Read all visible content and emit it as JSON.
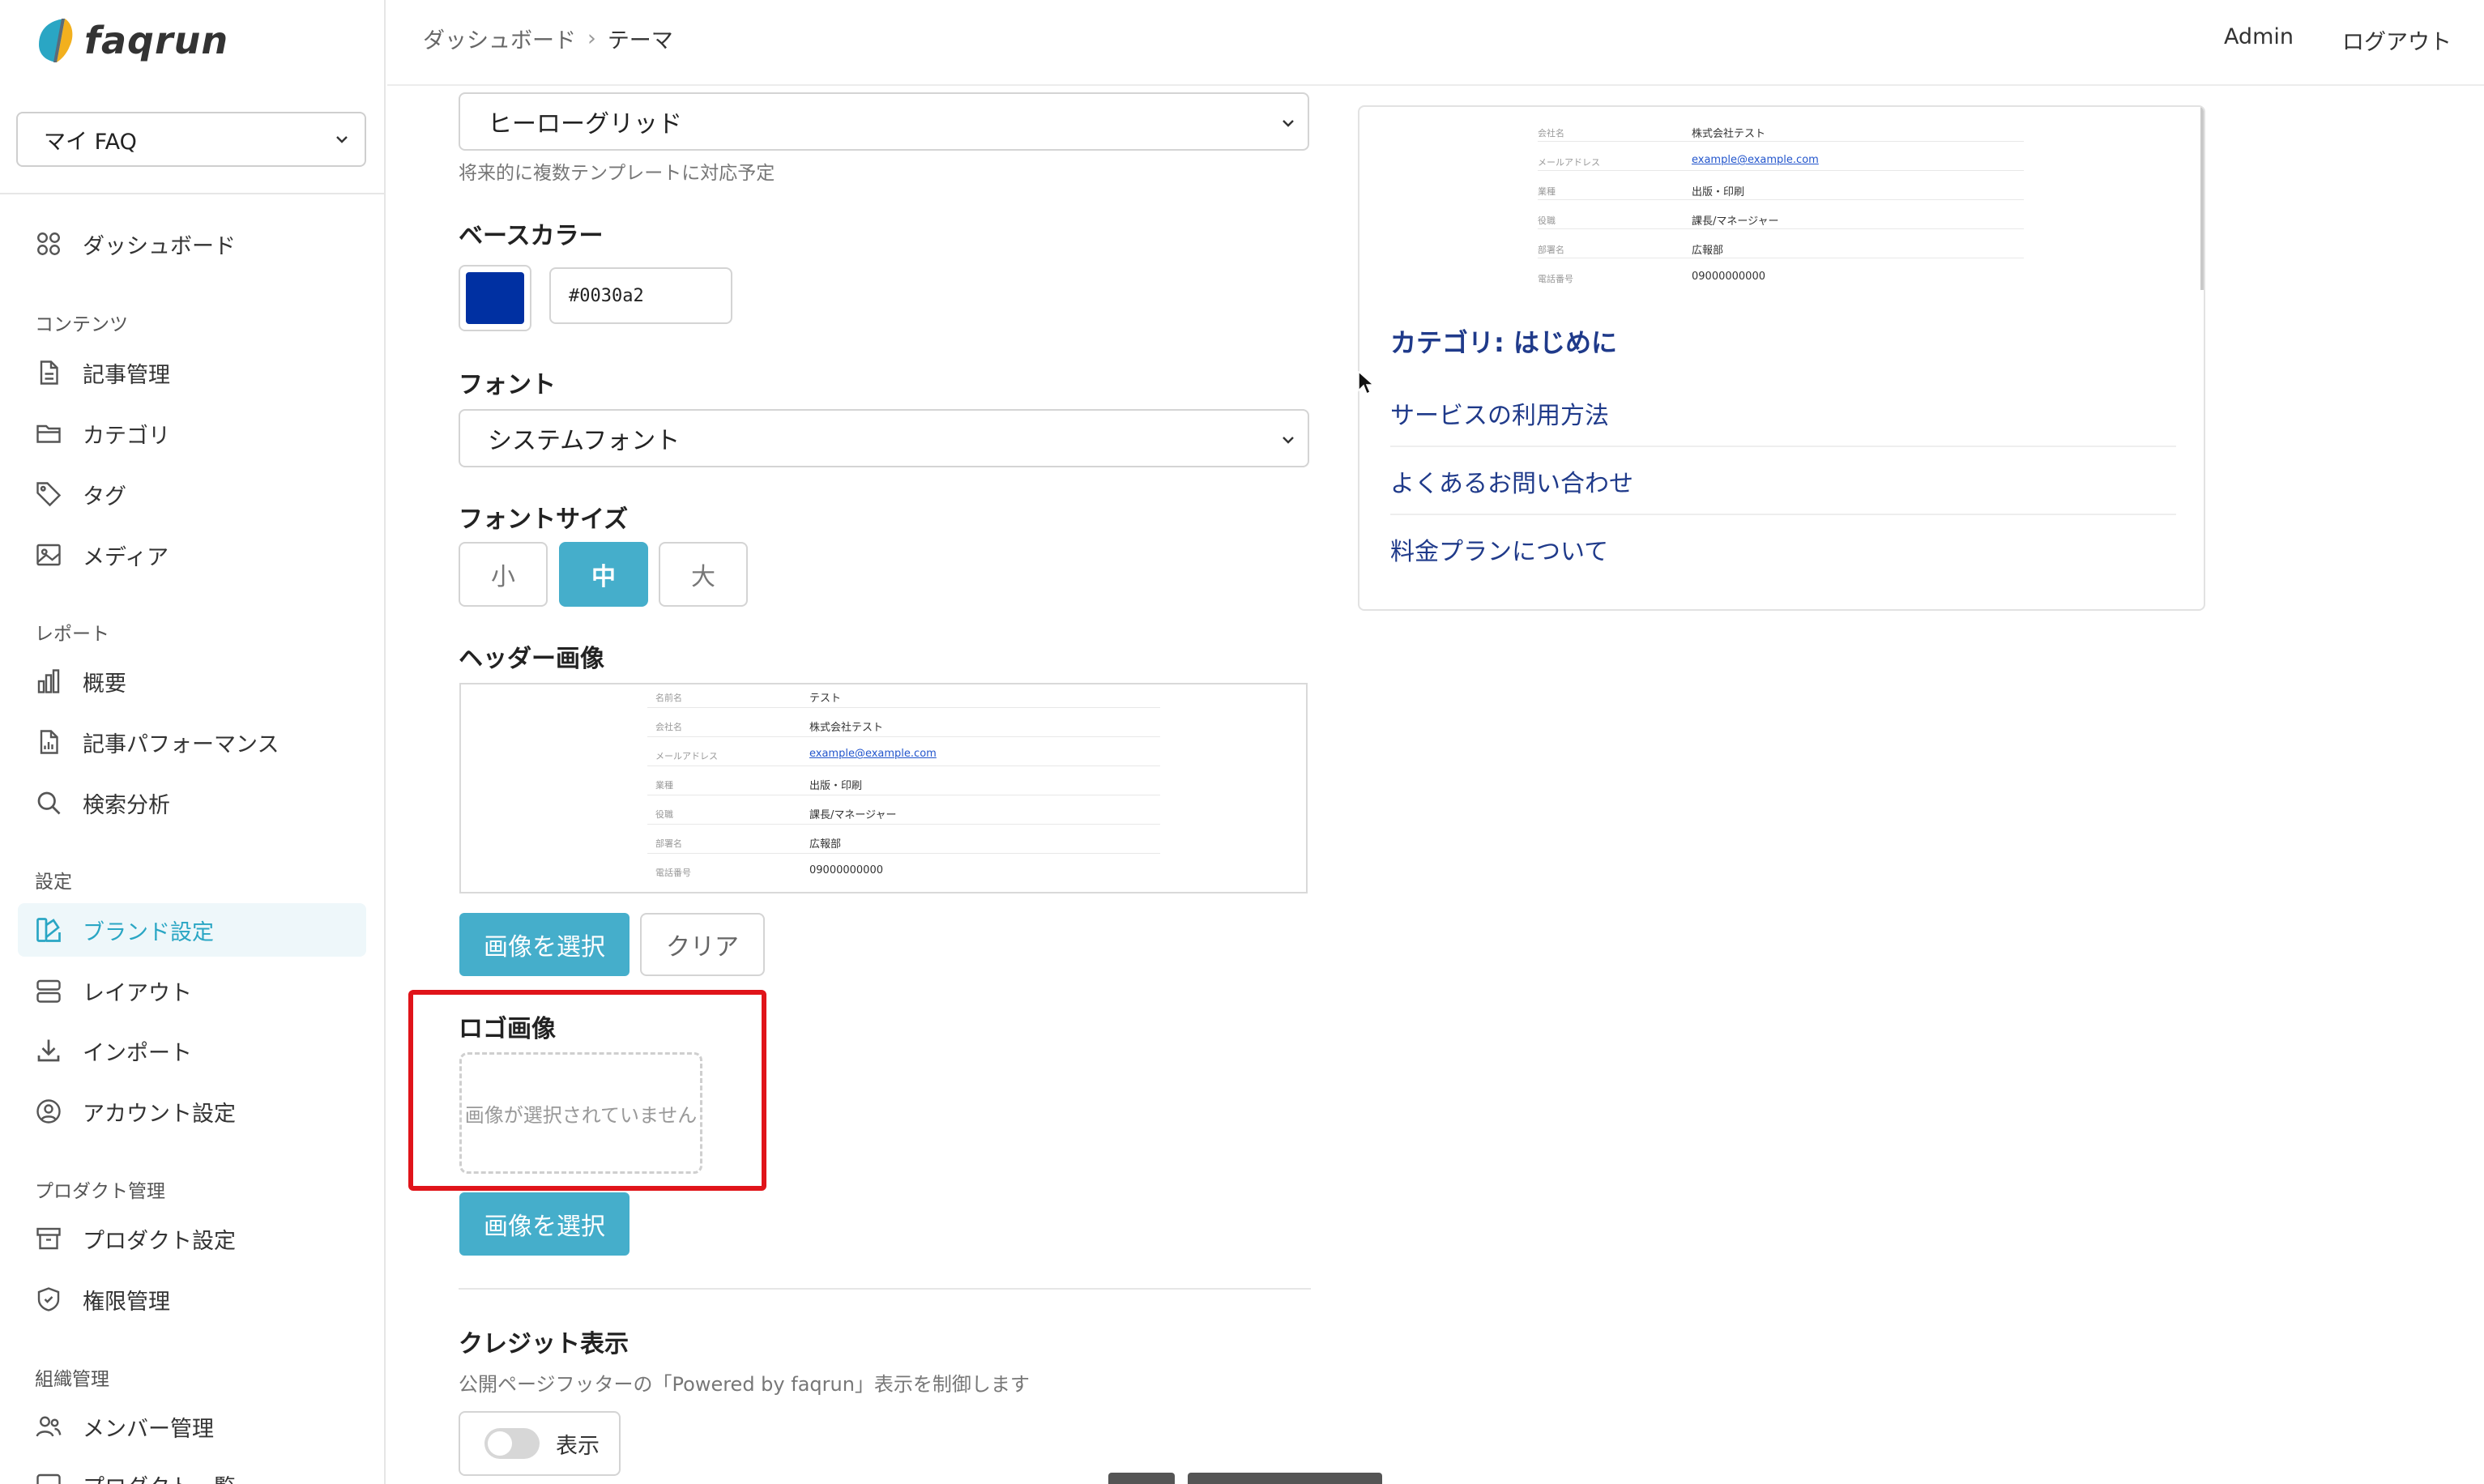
{
  "app": {
    "name": "faqrun"
  },
  "header": {
    "breadcrumb": [
      "ダッシュボード",
      "テーマ"
    ],
    "user": "Admin",
    "logout": "ログアウト"
  },
  "sidebar": {
    "faq_select": "マイ FAQ",
    "dashboard": "ダッシュボード",
    "sections": {
      "content": "コンテンツ",
      "report": "レポート",
      "settings": "設定",
      "product": "プロダクト管理",
      "org": "組織管理"
    },
    "items": {
      "articles": "記事管理",
      "categories": "カテゴリ",
      "tags": "タグ",
      "media": "メディア",
      "overview": "概要",
      "article_performance": "記事パフォーマンス",
      "search_analysis": "検索分析",
      "brand_settings": "ブランド設定",
      "layout": "レイアウト",
      "import": "インポート",
      "account_settings": "アカウント設定",
      "product_settings": "プロダクト設定",
      "permissions": "権限管理",
      "members": "メンバー管理",
      "product_list": "プロダクト一覧"
    }
  },
  "form": {
    "template": {
      "value": "ヒーローグリッド",
      "hint": "将来的に複数テンプレートに対応予定"
    },
    "base_color": {
      "label": "ベースカラー",
      "value": "#0030a2",
      "color": "#0030a2"
    },
    "font": {
      "label": "フォント",
      "value": "システムフォント"
    },
    "font_size": {
      "label": "フォントサイズ",
      "options": [
        "小",
        "中",
        "大"
      ],
      "selected": "中"
    },
    "header_image": {
      "label": "ヘッダー画像",
      "select_button": "画像を選択",
      "clear_button": "クリア",
      "doc": {
        "k1": "名前名",
        "v1": "テスト",
        "k2": "会社名",
        "v2": "株式会社テスト",
        "k3": "メールアドレス",
        "v3": "example@example.com",
        "k4": "業種",
        "v4": "出版・印刷",
        "k5": "役職",
        "v5": "課長/マネージャー",
        "k6": "部署名",
        "v6": "広報部",
        "k7": "電話番号",
        "v7": "09000000000"
      }
    },
    "logo_image": {
      "label": "ロゴ画像",
      "empty_text": "画像が選択されていません",
      "select_button": "画像を選択"
    },
    "credit": {
      "label": "クレジット表示",
      "hint": "公開ページフッターの「Powered by faqrun」表示を制御します",
      "toggle_label": "表示",
      "enabled": false
    }
  },
  "preview": {
    "doc": {
      "k1": "会社名",
      "v1": "株式会社テスト",
      "k2": "メールアドレス",
      "v2": "example@example.com",
      "k3": "業種",
      "v3": "出版・印刷",
      "k4": "役職",
      "v4": "課長/マネージャー",
      "k5": "部署名",
      "v5": "広報部",
      "k6": "電話番号",
      "v6": "09000000000"
    },
    "category_title": "カテゴリ: はじめに",
    "links": [
      "サービスの利用方法",
      "よくあるお問い合わせ",
      "料金プランについて"
    ]
  },
  "colors": {
    "accent": "#45aecb",
    "active_nav_bg": "#eef7fa",
    "link_blue": "#1f3a8a",
    "highlight_frame": "#e0141a"
  },
  "icons": {
    "dashboard": "grid-icon",
    "articles": "document-icon",
    "categories": "folder-icon",
    "tags": "tag-icon",
    "media": "image-icon",
    "overview": "bar-chart-icon",
    "article_performance": "document-chart-icon",
    "search_analysis": "search-icon",
    "brand_settings": "palette-icon",
    "layout": "layout-icon",
    "import": "download-icon",
    "account_settings": "user-circle-icon",
    "product_settings": "archive-icon",
    "permissions": "shield-icon",
    "members": "users-icon"
  }
}
